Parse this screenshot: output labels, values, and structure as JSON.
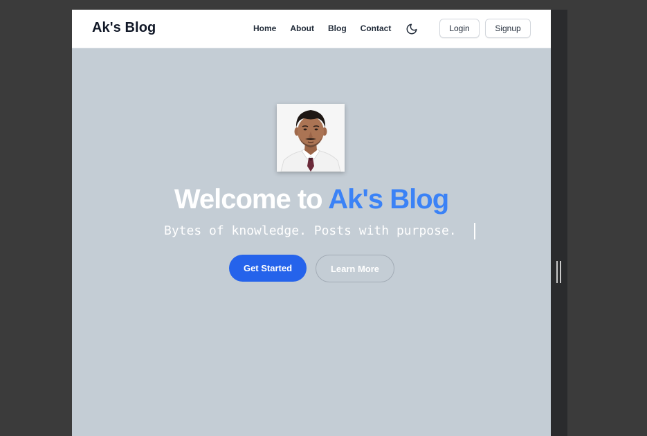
{
  "header": {
    "brand": "Ak's Blog",
    "nav": [
      {
        "label": "Home"
      },
      {
        "label": "About"
      },
      {
        "label": "Blog"
      },
      {
        "label": "Contact"
      }
    ],
    "theme_icon": "moon-icon",
    "login_label": "Login",
    "signup_label": "Signup"
  },
  "hero": {
    "avatar_icon": "profile-photo",
    "title_prefix": "Welcome to ",
    "title_accent": "Ak's Blog",
    "tagline": "Bytes of knowledge. Posts with purpose.",
    "primary_label": "Get Started",
    "secondary_label": "Learn More"
  },
  "colors": {
    "accent": "#3b82f6",
    "primary_button": "#2563eb",
    "hero_background": "#c4cdd5"
  }
}
